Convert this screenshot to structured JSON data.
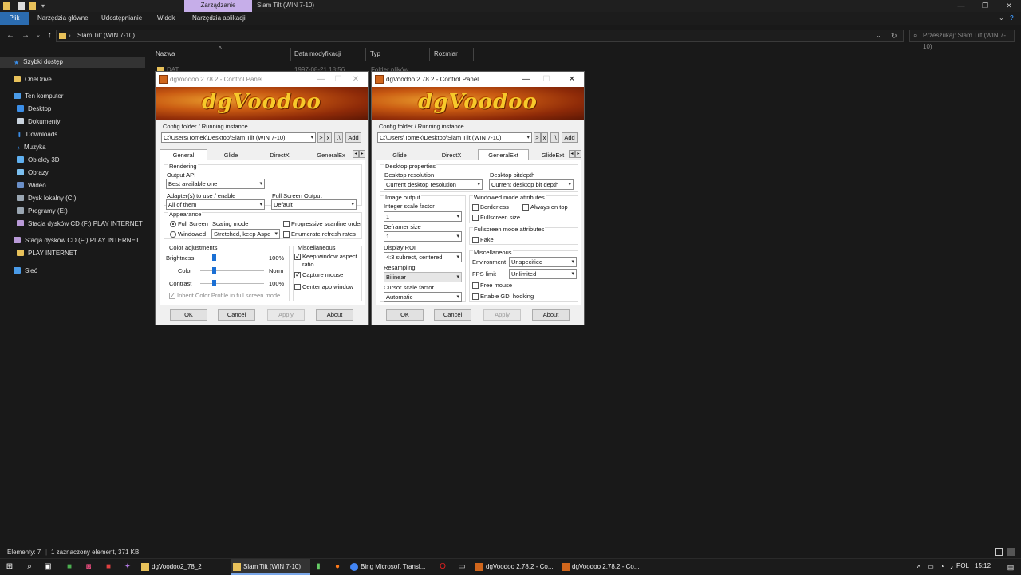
{
  "explorer": {
    "context_tab": "Zarządzanie",
    "title": "Slam Tilt (WIN 7-10)",
    "ribbon_tabs": [
      "Plik",
      "Narzędzia główne",
      "Udostępnianie",
      "Widok",
      "Narzędzia aplikacji"
    ],
    "address": "Slam Tilt (WIN 7-10)",
    "search_placeholder": "Przeszukaj: Slam Tilt (WIN 7-10)",
    "columns": [
      "Nazwa",
      "Data modyfikacji",
      "Typ",
      "Rozmiar"
    ],
    "file_row": {
      "name": "DAT",
      "date": "1997-08-21 18:56",
      "type": "Folder plików"
    },
    "sidebar": [
      {
        "label": "Szybki dostęp",
        "icon": "star-icon"
      },
      {
        "label": "OneDrive",
        "icon": "folder-icon"
      },
      {
        "label": "Ten komputer",
        "icon": "computer-icon"
      },
      {
        "label": "Desktop",
        "icon": "desktop-icon"
      },
      {
        "label": "Dokumenty",
        "icon": "documents-icon"
      },
      {
        "label": "Downloads",
        "icon": "download-icon"
      },
      {
        "label": "Muzyka",
        "icon": "music-icon"
      },
      {
        "label": "Obiekty 3D",
        "icon": "cube-icon"
      },
      {
        "label": "Obrazy",
        "icon": "pictures-icon"
      },
      {
        "label": "Wideo",
        "icon": "video-icon"
      },
      {
        "label": "Dysk lokalny (C:)",
        "icon": "drive-icon"
      },
      {
        "label": "Programy (E:)",
        "icon": "drive-icon"
      },
      {
        "label": "Stacja dysków CD (F:) PLAY INTERNET",
        "icon": "cd-drive-icon"
      },
      {
        "label": "Stacja dysków CD (F:) PLAY INTERNET",
        "icon": "cd-drive-icon"
      },
      {
        "label": "PLAY INTERNET",
        "icon": "folder-icon"
      },
      {
        "label": "Sieć",
        "icon": "network-icon"
      }
    ],
    "status": {
      "count": "Elementy: 7",
      "selection": "1 zaznaczony element, 371 KB"
    }
  },
  "dialog_common": {
    "title": "dgVoodoo 2.78.2 - Control Panel",
    "logo": "dgVoodoo",
    "config_label": "Config folder / Running instance",
    "config_path": "C:\\Users\\Tomek\\Desktop\\Slam Tilt (WIN 7-10)",
    "mini_buttons": [
      ">",
      "x",
      ".\\",
      "Add"
    ],
    "buttons": {
      "ok": "OK",
      "cancel": "Cancel",
      "apply": "Apply",
      "about": "About"
    }
  },
  "dialog_general": {
    "tabs": [
      "General",
      "Glide",
      "DirectX",
      "GeneralEx"
    ],
    "rendering": "Rendering",
    "output_api_label": "Output API",
    "output_api": "Best available one",
    "adapters_label": "Adapter(s) to use / enable",
    "adapters": "All of them",
    "fullscreen_output_label": "Full Screen Output",
    "fullscreen_output": "Default",
    "appearance": "Appearance",
    "full_screen": "Full Screen",
    "windowed": "Windowed",
    "scaling_mode_label": "Scaling mode",
    "scaling_mode": "Stretched, keep Aspe",
    "progressive": "Progressive scanline order",
    "enumerate": "Enumerate refresh rates",
    "color_adj": "Color adjustments",
    "brightness": "Brightness",
    "brightness_val": "100%",
    "color": "Color",
    "color_val": "Norm",
    "contrast": "Contrast",
    "contrast_val": "100%",
    "inherit": "Inherit Color Profile in full screen mode",
    "misc": "Miscellaneous",
    "keep_aspect": "Keep window aspect",
    "keep_aspect2": "ratio",
    "capture_mouse": "Capture mouse",
    "center_app": "Center app window"
  },
  "dialog_generalext": {
    "tabs": [
      "Glide",
      "DirectX",
      "GeneralExt",
      "GlideExt"
    ],
    "desktop_props": "Desktop properties",
    "desktop_res_label": "Desktop resolution",
    "desktop_res": "Current desktop resolution",
    "bitdepth_label": "Desktop bitdepth",
    "bitdepth": "Current desktop bit depth",
    "image_output": "Image output",
    "int_scale_label": "Integer scale factor",
    "int_scale": "1",
    "deframer_label": "Deframer size",
    "deframer": "1",
    "display_roi_label": "Display ROI",
    "display_roi": "4:3 subrect, centered",
    "resampling_label": "Resampling",
    "resampling": "Bilinear",
    "cursor_label": "Cursor scale factor",
    "cursor": "Automatic",
    "windowed_attr": "Windowed mode attributes",
    "borderless": "Borderless",
    "always_on_top": "Always on top",
    "fullscreen_size": "Fullscreen size",
    "fs_attr": "Fullscreen mode attributes",
    "fake": "Fake",
    "misc": "Miscellaneous",
    "environment_label": "Environment",
    "environment": "Unspecified",
    "fps_label": "FPS limit",
    "fps": "Unlimited",
    "free_mouse": "Free mouse",
    "gdi_hooking": "Enable GDI hooking"
  },
  "taskbar": {
    "apps": [
      "dgVoodoo2_78_2",
      "Slam Tilt (WIN 7-10)",
      "Bing Microsoft Transl...",
      "dgVoodoo 2.78.2 - Co...",
      "dgVoodoo 2.78.2 - Co..."
    ],
    "lang": "POL",
    "time": "15:12"
  },
  "colors": {
    "accent": "#2b6cb0",
    "folder": "#e8c15a",
    "slider_thumb": "#1a6fd4",
    "context_tab": "#c6aee9"
  }
}
